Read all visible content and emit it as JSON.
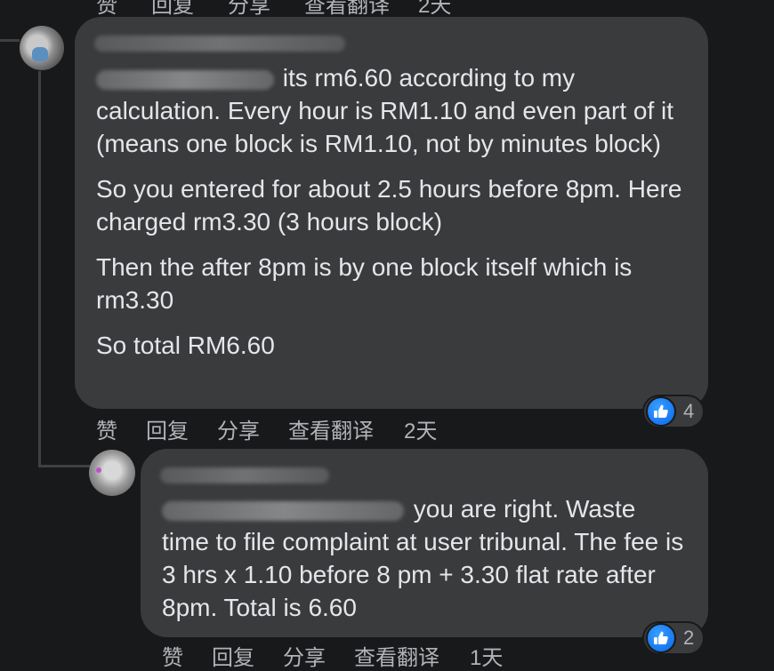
{
  "top_actions": [
    "赞",
    "回复",
    "分享",
    "查看翻译",
    "2天"
  ],
  "comment1": {
    "author": "Aorick Soo Kiet Ngu",
    "mention": "Malcolm Chua",
    "first_line_rest": " its rm6.60 according to my",
    "para1_rest": "calculation. Every hour is RM1.10 and even part of it (means one block is RM1.10, not by minutes block)",
    "para2": "So you entered for about 2.5 hours before 8pm. Here charged rm3.30 (3 hours block)",
    "para3": "Then the after 8pm is by one block itself which is rm3.30",
    "para4": "So total RM6.60",
    "actions": {
      "like": "赞",
      "reply": "回复",
      "share": "分享",
      "translate": "查看翻译",
      "time": "2天"
    },
    "reaction_count": "4",
    "reaction_icon": "thumbs-up-icon",
    "reaction_color": "#1877f2"
  },
  "comment2": {
    "author": "Cm... ...yam",
    "mention": "Aorick Soo Kiet Ngu",
    "first_line_rest": " you are right. Waste",
    "body_rest": "time to file complaint at user tribunal. The fee is 3 hrs x 1.10 before 8 pm + 3.30 flat rate after 8pm. Total is 6.60",
    "actions": {
      "like": "赞",
      "reply": "回复",
      "share": "分享",
      "translate": "查看翻译",
      "time": "1天"
    },
    "reaction_count": "2",
    "reaction_icon": "thumbs-up-icon",
    "reaction_color": "#1877f2"
  }
}
